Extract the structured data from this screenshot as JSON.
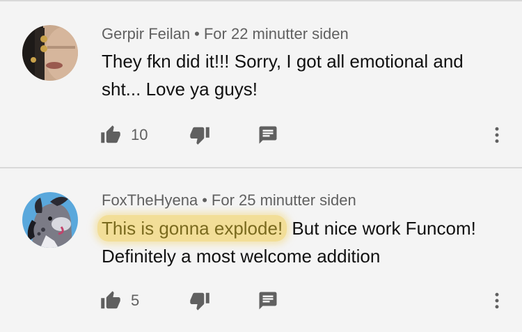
{
  "comments": [
    {
      "author": "Gerpir Feilan",
      "separator": "•",
      "time": "For 22 minutter siden",
      "text_highlight": "",
      "text": "They fkn did it!!! Sorry, I got all emotional and sht... Love ya guys!",
      "likes": "10",
      "icons": {
        "like": "thumb-up-icon",
        "dislike": "thumb-down-icon",
        "reply": "reply-icon",
        "more": "more-vert-icon"
      }
    },
    {
      "author": "FoxTheHyena",
      "separator": "•",
      "time": "For 25 minutter siden",
      "text_highlight": "This is gonna explode!",
      "text": " But nice work Funcom! Definitely a most welcome addition",
      "likes": "5",
      "icons": {
        "like": "thumb-up-icon",
        "dislike": "thumb-down-icon",
        "reply": "reply-icon",
        "more": "more-vert-icon"
      }
    }
  ],
  "colors": {
    "background": "#f4f4f4",
    "meta": "#606060",
    "text": "#111111",
    "icon": "#606060",
    "highlight": "#f2d77a"
  }
}
